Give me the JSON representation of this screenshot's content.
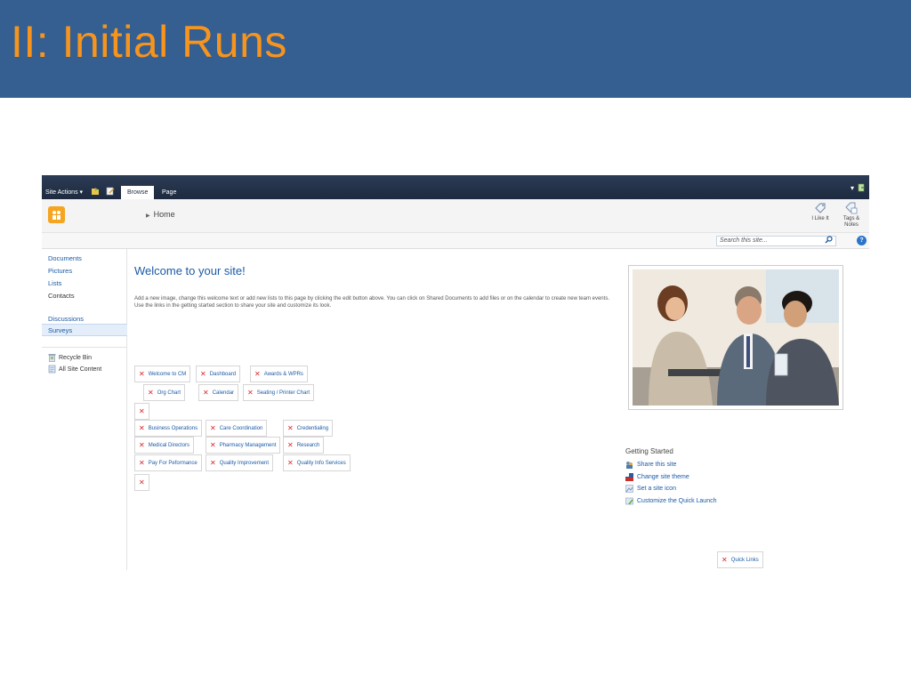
{
  "slide": {
    "title": "II: Initial Runs"
  },
  "ribbon": {
    "site_actions": "Site Actions ▾",
    "tabs": [
      {
        "label": "Browse"
      },
      {
        "label": "Page"
      }
    ],
    "right_glyph": "▪"
  },
  "title_area": {
    "breadcrumb": "Home",
    "like_label": "I Like It",
    "tags_label": "Tags &",
    "tags_label2": "Notes"
  },
  "search": {
    "placeholder": "Search this site...",
    "help": "?"
  },
  "left_nav": {
    "items": [
      "Documents",
      "Pictures",
      "Lists",
      "Contacts",
      "Discussions",
      "Surveys"
    ],
    "recycle_bin": "Recycle Bin",
    "all_site_content": "All Site Content"
  },
  "main": {
    "welcome_title": "Welcome to your site!",
    "welcome_text": "Add a new image, change this welcome text or add new lists to this page by clicking the edit button above. You can click on Shared Documents to add files or on the calendar to create new team events. Use the links in the getting started section to share your site and customize its look."
  },
  "tiles": {
    "welcome_cm": "Welcome to CM",
    "dashboard": "Dashboard",
    "awards": "Awards & WPRs",
    "org_chart": "Org Chart",
    "calendar": "Calendar",
    "seating": "Seating / Printer Chart",
    "business_ops": "Business Operations",
    "care_coord": "Care Coordination",
    "credentialing": "Credentialing",
    "medical_directors": "Medical Directors",
    "pharmacy": "Pharmacy Management",
    "research": "Research",
    "pay_performance": "Pay For Peformance",
    "quality_improvement": "Quality Improvement",
    "quality_info": "Quality Info Services",
    "quick_links": "Quick Links"
  },
  "getting_started": {
    "title": "Getting Started",
    "links": [
      "Share this site",
      "Change site theme",
      "Set a site icon",
      "Customize the Quick Launch"
    ]
  },
  "colors": {
    "header": "#355f91",
    "title": "#f7941d",
    "link": "#1c5aa5",
    "broken": "#d8262b"
  }
}
